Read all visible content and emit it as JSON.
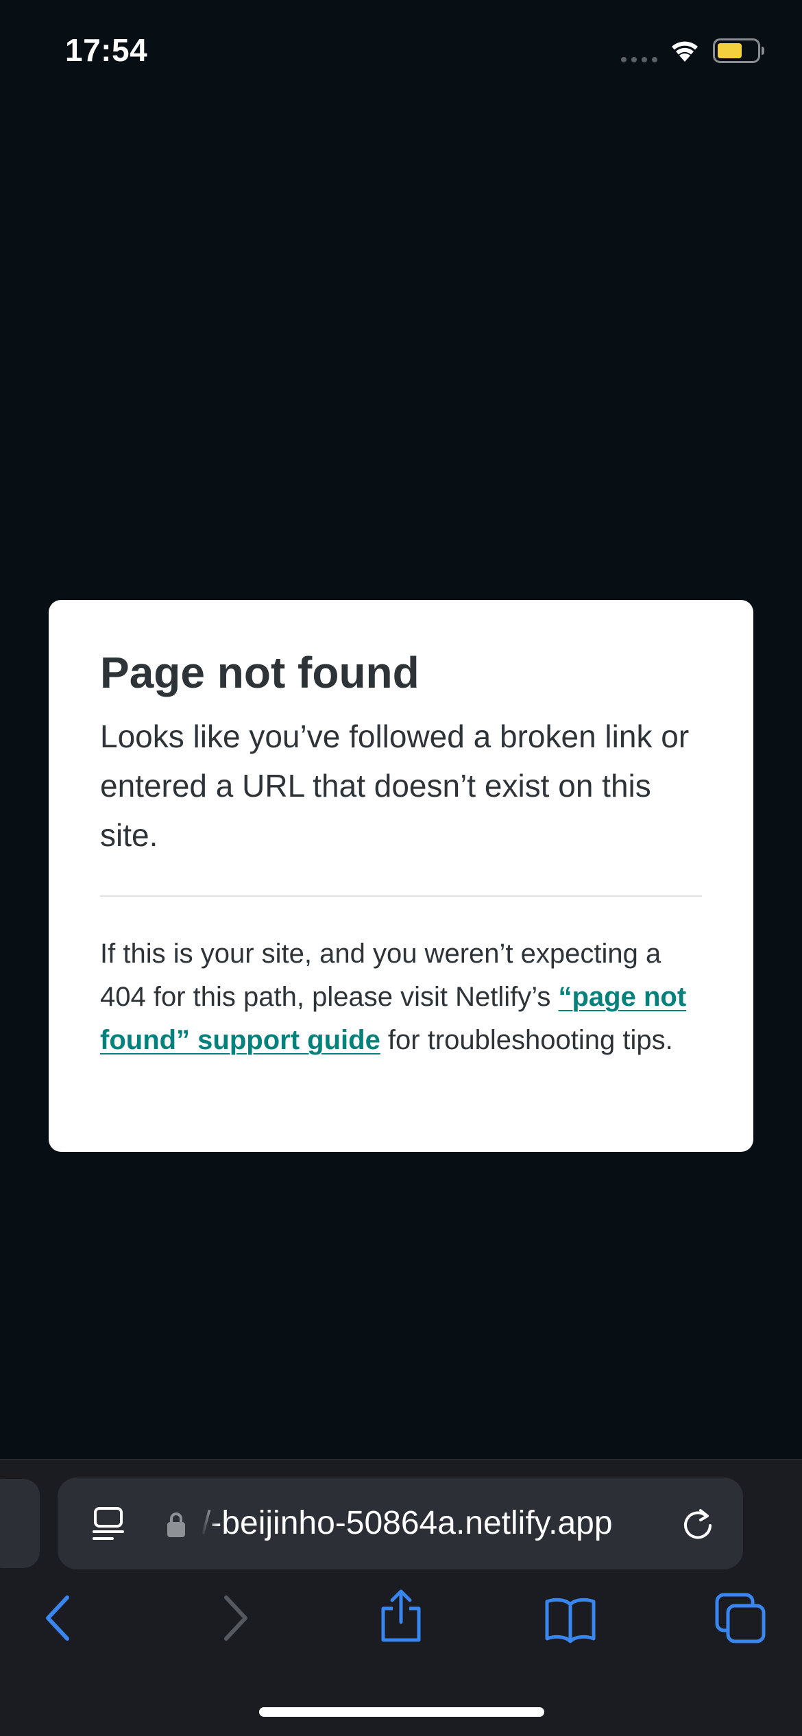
{
  "status_bar": {
    "time": "17:54",
    "icons": [
      "cellular-signal-icon",
      "wifi-icon",
      "battery-icon"
    ],
    "battery_color": "#f4d03f"
  },
  "card": {
    "title": "Page not found",
    "lead": "Looks like you’ve followed a broken link or entered a URL that doesn’t exist on this site.",
    "secondary_before": "If this is your site, and you weren’t expecting a 404 for this path, please visit Netlify’s ",
    "link_text": "“page not found” support guide",
    "secondary_after": " for troubleshooting tips.",
    "link_color": "#04817b"
  },
  "browser": {
    "url": "/-beijinho-50864a.netlify.app",
    "toolbar_icons": [
      "back-icon",
      "forward-icon",
      "share-icon",
      "bookmarks-icon",
      "tabs-icon"
    ],
    "accent_color": "#3a86f0"
  }
}
